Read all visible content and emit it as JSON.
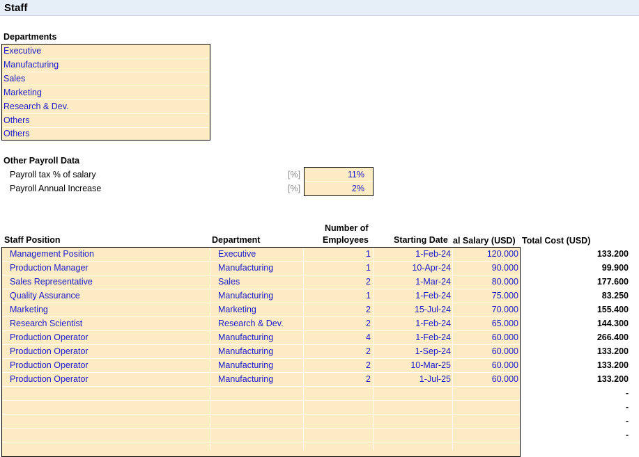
{
  "sheet": {
    "title": "Staff"
  },
  "departments": {
    "heading": "Departments",
    "items": [
      "Executive",
      "Manufacturing",
      "Sales",
      "Marketing",
      "Research & Dev.",
      "Others",
      "Others"
    ]
  },
  "payroll": {
    "heading": "Other Payroll Data",
    "rows": [
      {
        "label": "Payroll tax % of salary",
        "unit": "[%]",
        "value": "11%"
      },
      {
        "label": "Payroll Annual Increase",
        "unit": "[%]",
        "value": "2%"
      }
    ]
  },
  "staff_table": {
    "headers": {
      "position": "Staff Position",
      "department": "Department",
      "employees_line1": "Number of",
      "employees_line2": "Employees",
      "start_date": "Starting Date",
      "salary": "al Salary (USD)",
      "total_cost": "Total Cost (USD)"
    },
    "rows": [
      {
        "position": "Management Position",
        "department": "Executive",
        "employees": "1",
        "start_date": "1-Feb-24",
        "salary": "120.000",
        "total_cost": "133.200"
      },
      {
        "position": "Production Manager",
        "department": "Manufacturing",
        "employees": "1",
        "start_date": "10-Apr-24",
        "salary": "90.000",
        "total_cost": "99.900"
      },
      {
        "position": "Sales Representative",
        "department": "Sales",
        "employees": "2",
        "start_date": "1-Mar-24",
        "salary": "80.000",
        "total_cost": "177.600"
      },
      {
        "position": "Quality Assurance",
        "department": "Manufacturing",
        "employees": "1",
        "start_date": "1-Feb-24",
        "salary": "75.000",
        "total_cost": "83.250"
      },
      {
        "position": "Marketing",
        "department": "Marketing",
        "employees": "2",
        "start_date": "15-Jul-24",
        "salary": "70.000",
        "total_cost": "155.400"
      },
      {
        "position": "Research Scientist",
        "department": "Research & Dev.",
        "employees": "2",
        "start_date": "1-Feb-24",
        "salary": "65.000",
        "total_cost": "144.300"
      },
      {
        "position": "Production Operator",
        "department": "Manufacturing",
        "employees": "4",
        "start_date": "1-Feb-24",
        "salary": "60.000",
        "total_cost": "266.400"
      },
      {
        "position": "Production Operator",
        "department": "Manufacturing",
        "employees": "2",
        "start_date": "1-Sep-24",
        "salary": "60.000",
        "total_cost": "133.200"
      },
      {
        "position": "Production Operator",
        "department": "Manufacturing",
        "employees": "2",
        "start_date": "10-Mar-25",
        "salary": "60.000",
        "total_cost": "133.200"
      },
      {
        "position": "Production Operator",
        "department": "Manufacturing",
        "employees": "2",
        "start_date": "1-Jul-25",
        "salary": "60.000",
        "total_cost": "133.200"
      },
      {
        "position": "",
        "department": "",
        "employees": "",
        "start_date": "",
        "salary": "",
        "total_cost": "-"
      },
      {
        "position": "",
        "department": "",
        "employees": "",
        "start_date": "",
        "salary": "",
        "total_cost": "-"
      },
      {
        "position": "",
        "department": "",
        "employees": "",
        "start_date": "",
        "salary": "",
        "total_cost": "-"
      },
      {
        "position": "",
        "department": "",
        "employees": "",
        "start_date": "",
        "salary": "",
        "total_cost": "-"
      }
    ]
  },
  "colors": {
    "input_fill": "#fdebc4",
    "input_text": "#1a1acc",
    "title_bar": "#e6eef8"
  }
}
